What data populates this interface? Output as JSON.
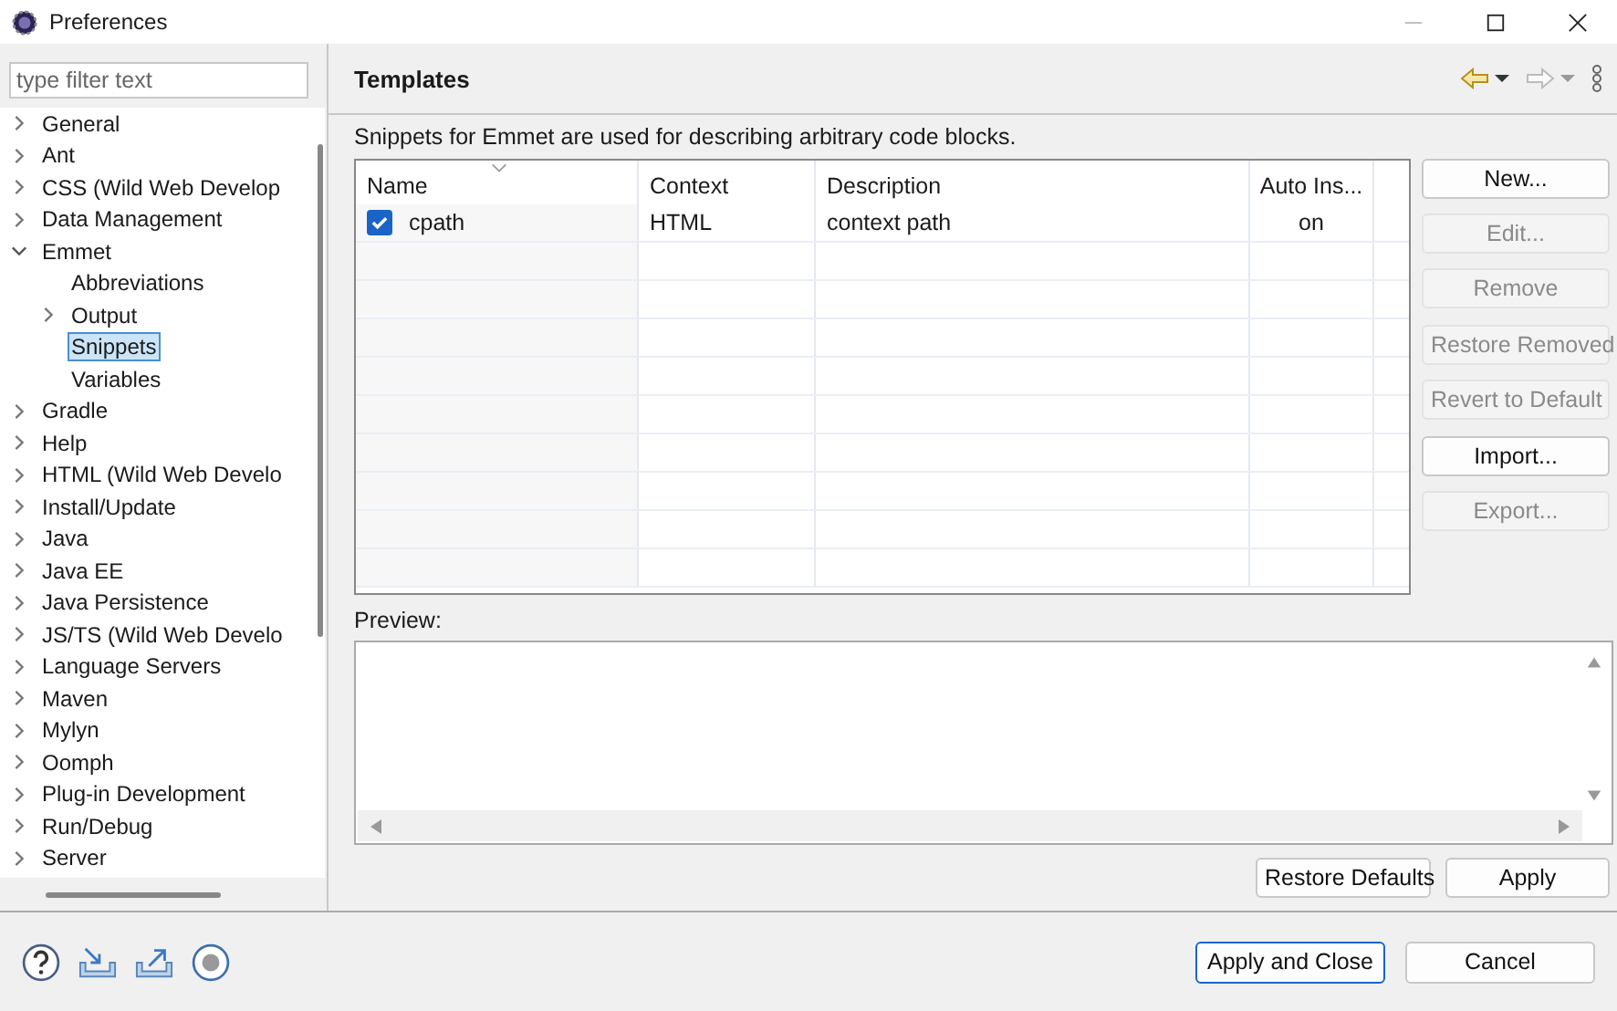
{
  "window": {
    "title": "Preferences"
  },
  "filter": {
    "placeholder": "type filter text"
  },
  "tree": [
    {
      "label": "General",
      "expanded": false,
      "selected": false
    },
    {
      "label": "Ant",
      "expanded": false,
      "selected": false
    },
    {
      "label": "CSS (Wild Web Develop",
      "expanded": false,
      "selected": false
    },
    {
      "label": "Data Management",
      "expanded": false,
      "selected": false
    },
    {
      "label": "Emmet",
      "expanded": true,
      "selected": false,
      "children": [
        {
          "label": "Abbreviations",
          "selected": false
        },
        {
          "label": "Output",
          "expanded": false,
          "selected": false
        },
        {
          "label": "Snippets",
          "selected": true
        },
        {
          "label": "Variables",
          "selected": false
        }
      ]
    },
    {
      "label": "Gradle",
      "expanded": false,
      "selected": false
    },
    {
      "label": "Help",
      "expanded": false,
      "selected": false
    },
    {
      "label": "HTML (Wild Web Develo",
      "expanded": false,
      "selected": false
    },
    {
      "label": "Install/Update",
      "expanded": false,
      "selected": false
    },
    {
      "label": "Java",
      "expanded": false,
      "selected": false
    },
    {
      "label": "Java EE",
      "expanded": false,
      "selected": false
    },
    {
      "label": "Java Persistence",
      "expanded": false,
      "selected": false
    },
    {
      "label": "JS/TS (Wild Web Develo",
      "expanded": false,
      "selected": false
    },
    {
      "label": "Language Servers",
      "expanded": false,
      "selected": false
    },
    {
      "label": "Maven",
      "expanded": false,
      "selected": false
    },
    {
      "label": "Mylyn",
      "expanded": false,
      "selected": false
    },
    {
      "label": "Oomph",
      "expanded": false,
      "selected": false
    },
    {
      "label": "Plug-in Development",
      "expanded": false,
      "selected": false
    },
    {
      "label": "Run/Debug",
      "expanded": false,
      "selected": false
    },
    {
      "label": "Server",
      "expanded": false,
      "selected": false
    }
  ],
  "page": {
    "title": "Templates",
    "description": "Snippets for Emmet are used for describing arbitrary code blocks."
  },
  "table": {
    "columns": [
      "Name",
      "Context",
      "Description",
      "Auto Ins..."
    ],
    "rows": [
      {
        "checked": true,
        "cells": [
          "cpath",
          "HTML",
          "context path",
          "on"
        ]
      }
    ]
  },
  "side_buttons": [
    [
      {
        "label": "New...",
        "disabled": false
      },
      {
        "label": "Edit...",
        "disabled": true
      },
      {
        "label": "Remove",
        "disabled": true
      }
    ],
    [
      {
        "label": "Restore Removed",
        "disabled": true
      },
      {
        "label": "Revert to Default",
        "disabled": true
      }
    ],
    [
      {
        "label": "Import...",
        "disabled": false
      },
      {
        "label": "Export...",
        "disabled": true
      }
    ]
  ],
  "preview": {
    "label": "Preview:"
  },
  "page_buttons": [
    "Restore Defaults",
    "Apply"
  ],
  "dialog_buttons": [
    {
      "label": "Apply and Close",
      "default": true
    },
    {
      "label": "Cancel",
      "default": false
    }
  ]
}
